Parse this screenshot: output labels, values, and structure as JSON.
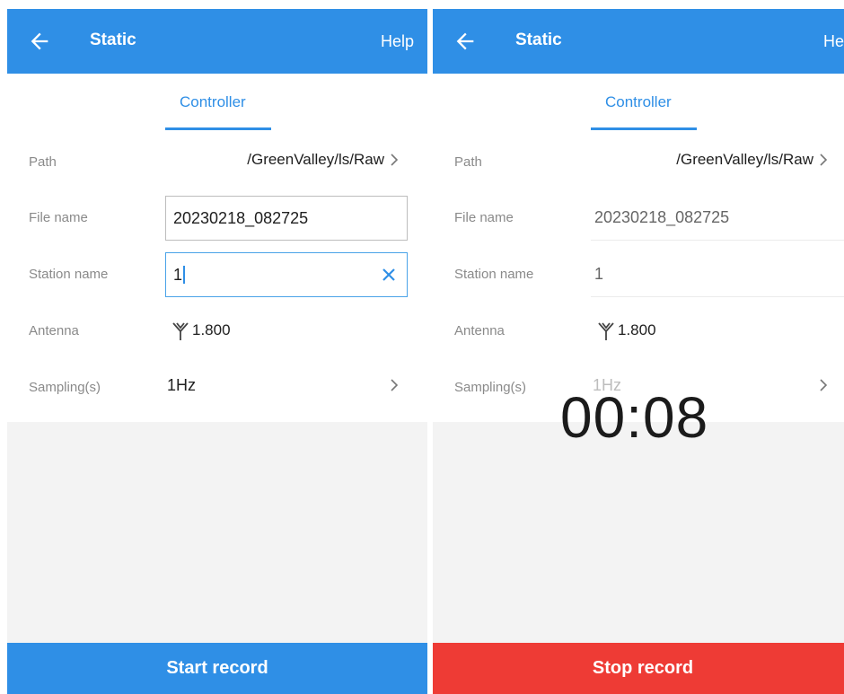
{
  "left_screen": {
    "title": "Static",
    "help": "Help",
    "tab": "Controller",
    "path": {
      "label": "Path",
      "value": "/GreenValley/ls/Raw"
    },
    "file_name": {
      "label": "File name",
      "value": "20230218_082725"
    },
    "station_name": {
      "label": "Station name",
      "value": "1"
    },
    "antenna": {
      "label": "Antenna",
      "value": "1.800"
    },
    "sampling": {
      "label": "Sampling(s)",
      "value": "1Hz"
    },
    "button": "Start record"
  },
  "right_screen": {
    "title": "Static",
    "help": "Help",
    "tab": "Controller",
    "path": {
      "label": "Path",
      "value": "/GreenValley/ls/Raw"
    },
    "file_name": {
      "label": "File name",
      "value": "20230218_082725"
    },
    "station_name": {
      "label": "Station name",
      "value": "1"
    },
    "antenna": {
      "label": "Antenna",
      "value": "1.800"
    },
    "sampling": {
      "label": "Sampling(s)",
      "value": "1Hz"
    },
    "timer": "00:08",
    "button": "Stop record"
  },
  "colors": {
    "primary": "#2f8fe6",
    "stop": "#ee3b35",
    "background_gray": "#f3f3f3"
  },
  "icons": [
    "back-arrow-icon",
    "chevron-right-icon",
    "clear-x-icon",
    "antenna-icon"
  ]
}
